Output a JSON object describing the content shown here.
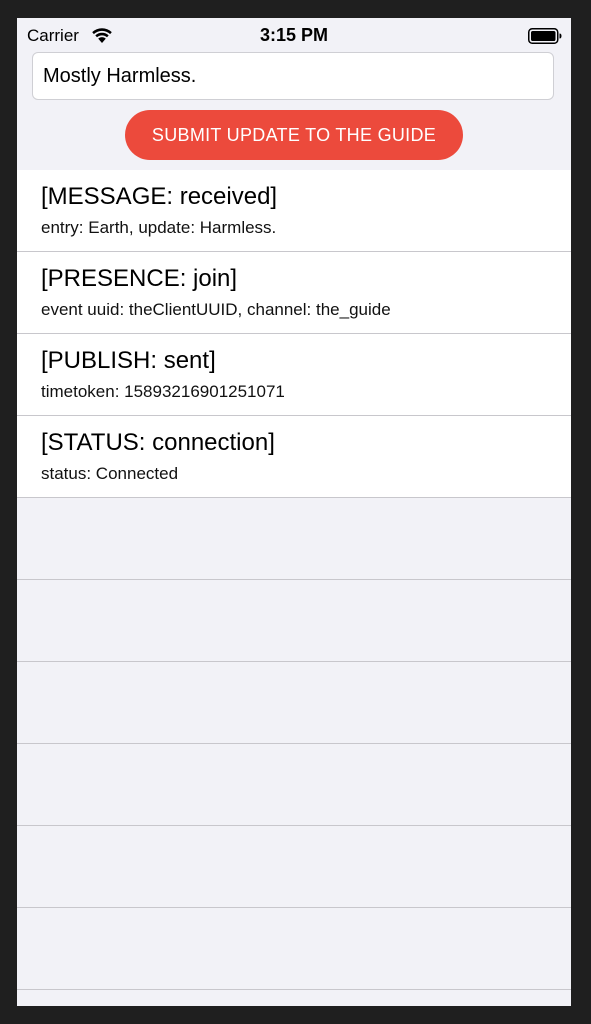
{
  "status_bar": {
    "carrier": "Carrier",
    "time": "3:15 PM",
    "wifi_icon": "wifi-icon",
    "battery_icon": "battery-full-icon"
  },
  "input": {
    "value": "Mostly Harmless.",
    "placeholder": ""
  },
  "submit_button": {
    "label": "SUBMIT UPDATE TO THE GUIDE",
    "color": "#ec4a3c"
  },
  "events": [
    {
      "title": "[MESSAGE: received]",
      "subtitle": "entry: Earth, update: Harmless."
    },
    {
      "title": "[PRESENCE: join]",
      "subtitle": "event uuid: theClientUUID, channel: the_guide"
    },
    {
      "title": "[PUBLISH: sent]",
      "subtitle": "timetoken: 15893216901251071"
    },
    {
      "title": "[STATUS: connection]",
      "subtitle": "status: Connected"
    }
  ],
  "colors": {
    "background": "#f2f2f7",
    "separator": "#c8c7cc",
    "accent": "#ec4a3c"
  }
}
